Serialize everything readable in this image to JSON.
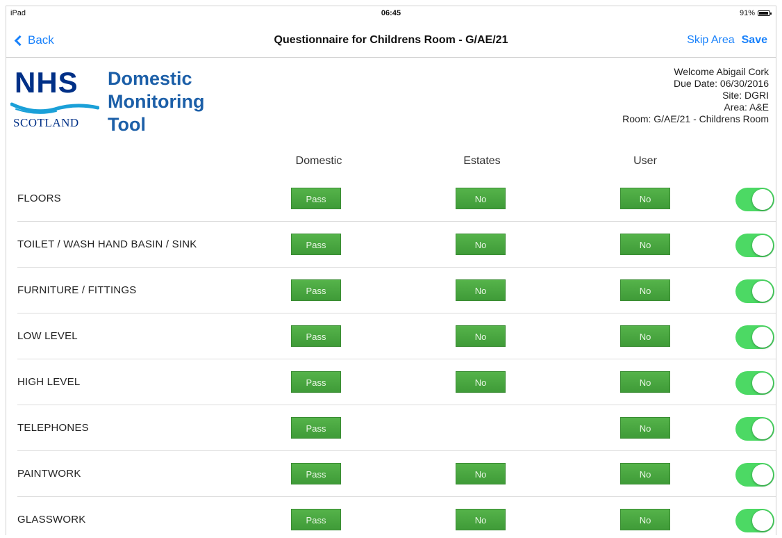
{
  "status_bar": {
    "carrier": "iPad",
    "time": "06:45",
    "battery": "91%"
  },
  "nav": {
    "back_label": "Back",
    "title": "Questionnaire for Childrens Room - G/AE/21",
    "skip_label": "Skip Area",
    "save_label": "Save"
  },
  "logo": {
    "top": "NHS",
    "bottom": "SCOTLAND"
  },
  "app": {
    "title_line1": "Domestic",
    "title_line2": "Monitoring",
    "title_line3": "Tool"
  },
  "info": {
    "welcome": "Welcome Abigail Cork",
    "due_date": "Due Date: 06/30/2016",
    "site": "Site: DGRI",
    "area": "Area: A&E",
    "room": "Room: G/AE/21 - Childrens Room"
  },
  "columns": {
    "domestic": "Domestic",
    "estates": "Estates",
    "user": "User"
  },
  "rows": [
    {
      "label": "FLOORS",
      "domestic": "Pass",
      "estates": "No",
      "user": "No",
      "enabled": true
    },
    {
      "label": "TOILET / WASH HAND BASIN / SINK",
      "domestic": "Pass",
      "estates": "No",
      "user": "No",
      "enabled": true
    },
    {
      "label": "FURNITURE / FITTINGS",
      "domestic": "Pass",
      "estates": "No",
      "user": "No",
      "enabled": true
    },
    {
      "label": "LOW LEVEL",
      "domestic": "Pass",
      "estates": "No",
      "user": "No",
      "enabled": true
    },
    {
      "label": "HIGH LEVEL",
      "domestic": "Pass",
      "estates": "No",
      "user": "No",
      "enabled": true
    },
    {
      "label": "TELEPHONES",
      "domestic": "Pass",
      "estates": "",
      "user": "No",
      "enabled": true
    },
    {
      "label": "PAINTWORK",
      "domestic": "Pass",
      "estates": "No",
      "user": "No",
      "enabled": true
    },
    {
      "label": "GLASSWORK",
      "domestic": "Pass",
      "estates": "No",
      "user": "No",
      "enabled": true
    }
  ],
  "colors": {
    "accent": "#1a82fb",
    "nhs_blue": "#003087",
    "title_blue": "#1c5fa8",
    "button_green": "#4aa841",
    "toggle_green": "#4cd964"
  }
}
